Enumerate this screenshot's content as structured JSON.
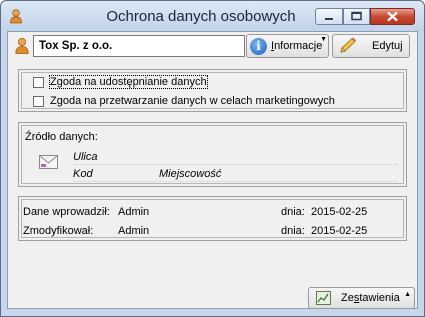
{
  "window": {
    "title": "Ochrona danych osobowych"
  },
  "header": {
    "company": "Tox Sp. z o.o.",
    "info_button_prefix": "I",
    "info_button_rest": "nformacje",
    "edit_button": "Edytuj"
  },
  "consents": [
    {
      "label": "Zgoda na udostępnianie danych",
      "checked": false
    },
    {
      "label": "Zgoda na przetwarzanie danych w celach marketingowych",
      "checked": false
    }
  ],
  "source": {
    "label": "Źródło danych:",
    "street": "Ulica",
    "postal_code": "Kod",
    "city": "Miejscowość"
  },
  "meta": {
    "entered_label": "Dane wprowadził:",
    "entered_by": "Admin",
    "entered_date_label": "dnia:",
    "entered_date": "2015-02-25",
    "modified_label": "Zmodyfikował:",
    "modified_by": "Admin",
    "modified_date_label": "dnia:",
    "modified_date": "2015-02-25"
  },
  "footer": {
    "summary_button_prefix": "Ze",
    "summary_button_underlined": "s",
    "summary_button_rest": "tawienia"
  },
  "colors": {
    "title_bar": "#c7d6ea",
    "close_button": "#c64b33",
    "client_bg": "#f0f0f0"
  },
  "icons": {
    "app": "person-icon",
    "info": "info-icon",
    "edit": "pencil-icon",
    "address": "envelope-icon",
    "summary": "chart-icon"
  }
}
